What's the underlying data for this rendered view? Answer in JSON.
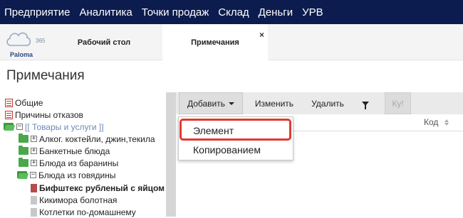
{
  "menu": [
    "Предприятие",
    "Аналитика",
    "Точки продаж",
    "Склад",
    "Деньги",
    "УРВ"
  ],
  "logo": {
    "brand": "Paloma",
    "version": "365"
  },
  "tabs": [
    {
      "label": "Рабочий стол",
      "active": false
    },
    {
      "label": "Примечания",
      "active": true,
      "close": "×"
    }
  ],
  "page_title": "Примечания",
  "tree": {
    "general": "Общие",
    "refusal_reasons": "Причины отказов",
    "goods_root": "[[ Товары и услуги ]]",
    "alcohol": "Алког. коктейли, джин,текила",
    "banquet": "Банкетные блюда",
    "lamb": "Блюда из баранины",
    "beef": "Блюда из говядины",
    "beef_items": [
      "Бифштекс рубленый с яйцом",
      "Кикимора болотная",
      "Котлетки по-домашнему"
    ]
  },
  "toolbar": {
    "add": "Добавить",
    "edit": "Изменить",
    "delete": "Удалить",
    "ku": "Ку!"
  },
  "grid": {
    "col_code": "Код"
  },
  "dropdown": {
    "item_element": "Элемент",
    "item_copy": "Копированием"
  },
  "colors": {
    "topbar": "#0c1c4e",
    "highlight": "#e03a2f",
    "folder": "#4aa84a"
  }
}
